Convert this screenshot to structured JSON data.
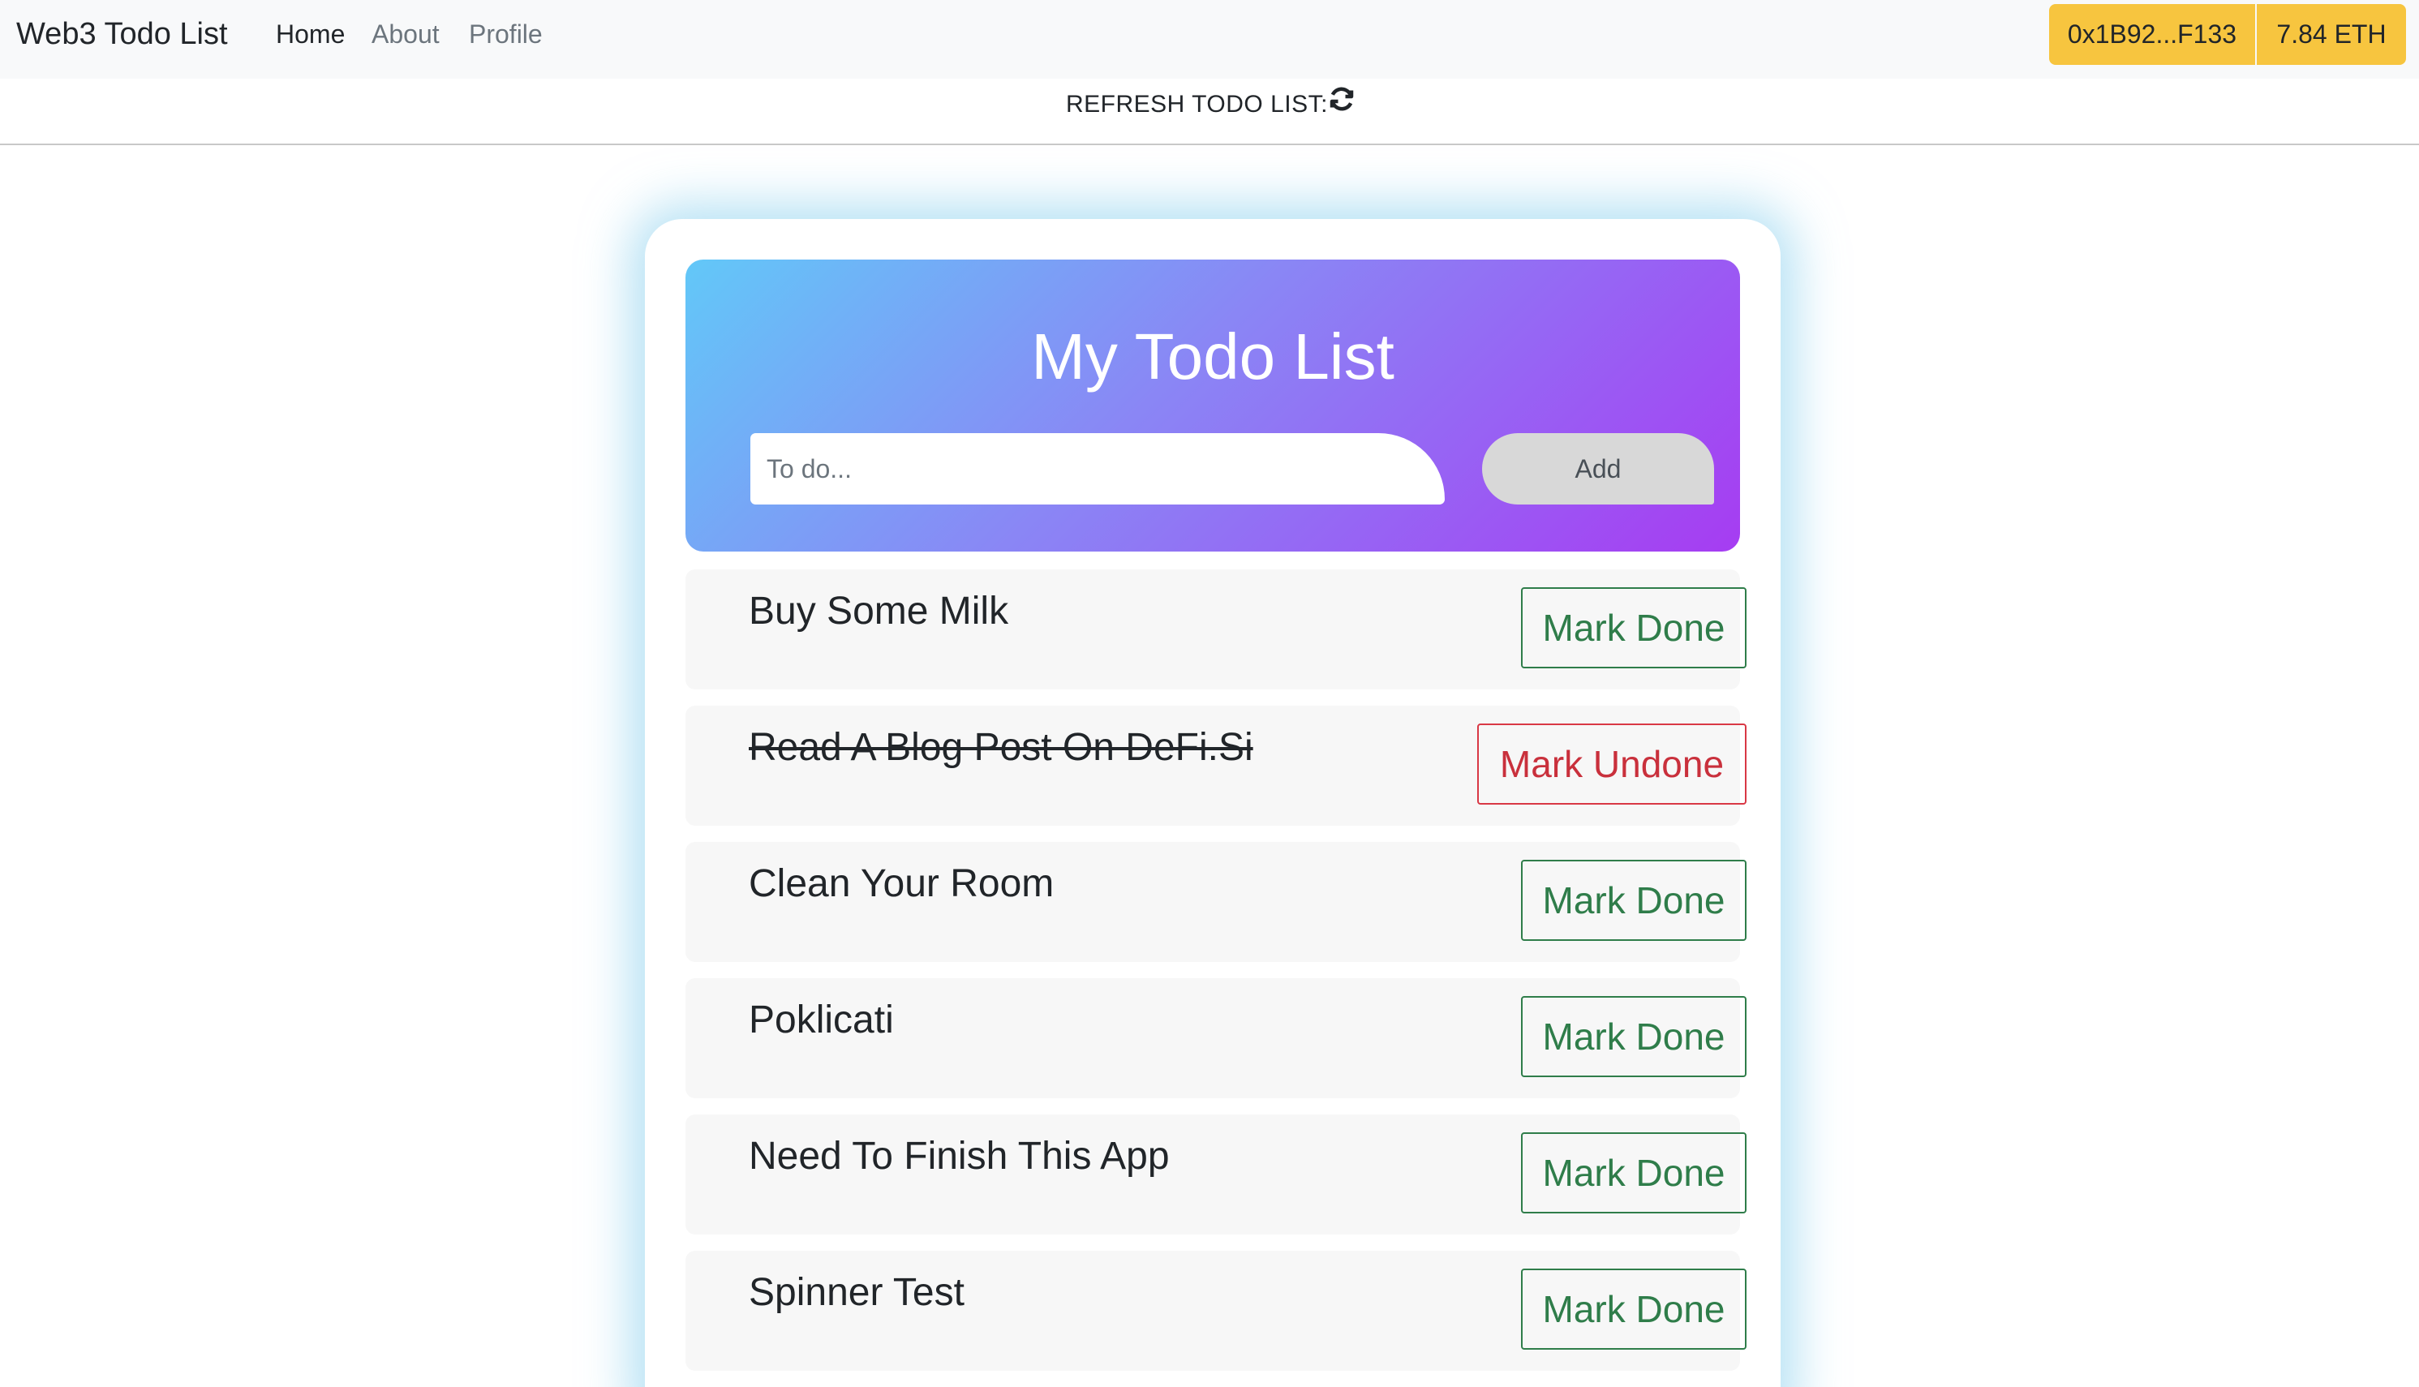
{
  "navbar": {
    "brand": "Web3 Todo List",
    "links": [
      {
        "label": "Home",
        "active": true
      },
      {
        "label": "About",
        "active": false
      },
      {
        "label": "Profile",
        "active": false
      }
    ],
    "wallet_address": "0x1B92...F133",
    "balance": "7.84 ETH",
    "accent_color": "#f7c53f"
  },
  "refresh": {
    "label": "REFRESH TODO LIST:",
    "icon": "refresh-icon"
  },
  "card": {
    "title": "My Todo List",
    "input_placeholder": "To do...",
    "input_value": "",
    "add_label": "Add",
    "gradient_colors": [
      "#62c8f8",
      "#8a86f5",
      "#a63cf2"
    ]
  },
  "todos": [
    {
      "text": "Buy Some Milk",
      "done": false,
      "action": "Mark Done"
    },
    {
      "text": "Read A Blog Post On DeFi.Si",
      "done": true,
      "action": "Mark Undone"
    },
    {
      "text": "Clean Your Room",
      "done": false,
      "action": "Mark Done"
    },
    {
      "text": "Poklicati",
      "done": false,
      "action": "Mark Done"
    },
    {
      "text": "Need To Finish This App",
      "done": false,
      "action": "Mark Done"
    },
    {
      "text": "Spinner Test",
      "done": false,
      "action": "Mark Done"
    }
  ],
  "colors": {
    "done_button": "#2f7d4a",
    "undone_button": "#c9303c"
  }
}
